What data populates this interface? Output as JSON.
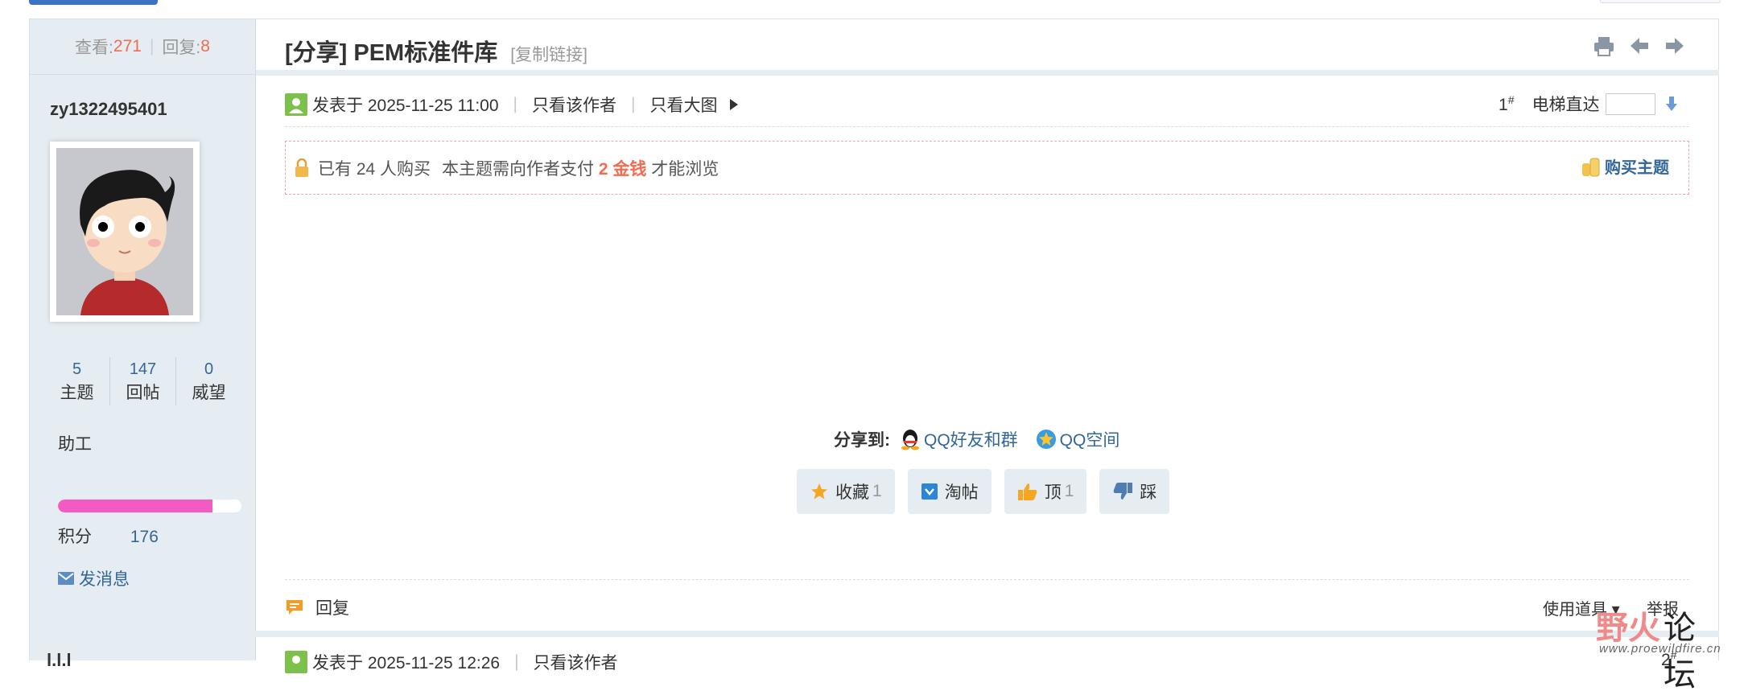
{
  "thread": {
    "views_label": "查看:",
    "views": "271",
    "sep": "|",
    "replies_label": "回复:",
    "replies": "8",
    "title": "[分享] PEM标准件库",
    "copy_link": "[复制链接]"
  },
  "author": {
    "username": "zy1322495401",
    "stats": [
      {
        "value": "5",
        "label": "主题"
      },
      {
        "value": "147",
        "label": "回帖"
      },
      {
        "value": "0",
        "label": "威望"
      }
    ],
    "rank": "助工",
    "progress_fraction": 0.84,
    "credit_label": "积分",
    "credit_value": "176",
    "send_message": "发消息"
  },
  "post": {
    "posted_at": "发表于 2025-11-25 11:00",
    "sep": "|",
    "only_author": "只看该作者",
    "only_big_images": "只看大图",
    "floor_num": "1",
    "floor_sup": "#",
    "jump_label": "电梯直达",
    "paid_count_text": "已有 24 人购买",
    "paid_text_pre": "本主题需向作者支付",
    "paid_amount": "2 金钱",
    "paid_text_post": "才能浏览",
    "buy_label": "购买主题",
    "share_label": "分享到:",
    "share_qq": "QQ好友和群",
    "share_qzone": "QQ空间",
    "fav_label": "收藏",
    "fav_count": "1",
    "tao_label": "淘帖",
    "up_label": "顶",
    "up_count": "1",
    "down_label": "踩",
    "reply_label": "回复",
    "tools_label": "使用道具",
    "report_label": "举报"
  },
  "next_post": {
    "username": "l.l.l",
    "posted_at": "发表于 2025-11-25 12:26",
    "sep": "|",
    "only_author": "只看该作者",
    "floor_num": "2",
    "floor_sup": "#"
  },
  "watermark": {
    "text_a": "野火",
    "text_b": "论坛",
    "url": "www.proewildfire.cn"
  },
  "colors": {
    "accent_blue": "#336699",
    "highlight_red": "#f26c4f",
    "sidebar_bg": "#e5edf2",
    "progress_pink": "#f35bc4"
  }
}
